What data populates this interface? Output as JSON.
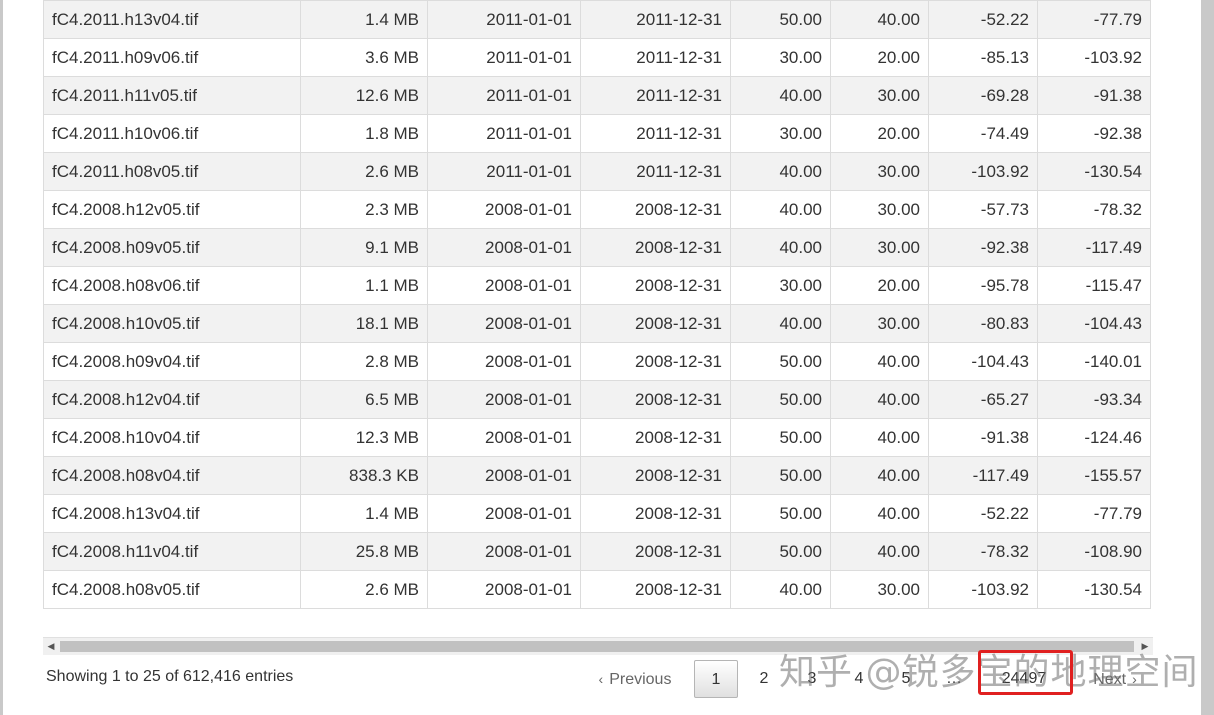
{
  "table": {
    "rows": [
      [
        "fC4.2011.h13v04.tif",
        "1.4 MB",
        "2011-01-01",
        "2011-12-31",
        "50.00",
        "40.00",
        "-52.22",
        "-77.79"
      ],
      [
        "fC4.2011.h09v06.tif",
        "3.6 MB",
        "2011-01-01",
        "2011-12-31",
        "30.00",
        "20.00",
        "-85.13",
        "-103.92"
      ],
      [
        "fC4.2011.h11v05.tif",
        "12.6 MB",
        "2011-01-01",
        "2011-12-31",
        "40.00",
        "30.00",
        "-69.28",
        "-91.38"
      ],
      [
        "fC4.2011.h10v06.tif",
        "1.8 MB",
        "2011-01-01",
        "2011-12-31",
        "30.00",
        "20.00",
        "-74.49",
        "-92.38"
      ],
      [
        "fC4.2011.h08v05.tif",
        "2.6 MB",
        "2011-01-01",
        "2011-12-31",
        "40.00",
        "30.00",
        "-103.92",
        "-130.54"
      ],
      [
        "fC4.2008.h12v05.tif",
        "2.3 MB",
        "2008-01-01",
        "2008-12-31",
        "40.00",
        "30.00",
        "-57.73",
        "-78.32"
      ],
      [
        "fC4.2008.h09v05.tif",
        "9.1 MB",
        "2008-01-01",
        "2008-12-31",
        "40.00",
        "30.00",
        "-92.38",
        "-117.49"
      ],
      [
        "fC4.2008.h08v06.tif",
        "1.1 MB",
        "2008-01-01",
        "2008-12-31",
        "30.00",
        "20.00",
        "-95.78",
        "-115.47"
      ],
      [
        "fC4.2008.h10v05.tif",
        "18.1 MB",
        "2008-01-01",
        "2008-12-31",
        "40.00",
        "30.00",
        "-80.83",
        "-104.43"
      ],
      [
        "fC4.2008.h09v04.tif",
        "2.8 MB",
        "2008-01-01",
        "2008-12-31",
        "50.00",
        "40.00",
        "-104.43",
        "-140.01"
      ],
      [
        "fC4.2008.h12v04.tif",
        "6.5 MB",
        "2008-01-01",
        "2008-12-31",
        "50.00",
        "40.00",
        "-65.27",
        "-93.34"
      ],
      [
        "fC4.2008.h10v04.tif",
        "12.3 MB",
        "2008-01-01",
        "2008-12-31",
        "50.00",
        "40.00",
        "-91.38",
        "-124.46"
      ],
      [
        "fC4.2008.h08v04.tif",
        "838.3 KB",
        "2008-01-01",
        "2008-12-31",
        "50.00",
        "40.00",
        "-117.49",
        "-155.57"
      ],
      [
        "fC4.2008.h13v04.tif",
        "1.4 MB",
        "2008-01-01",
        "2008-12-31",
        "50.00",
        "40.00",
        "-52.22",
        "-77.79"
      ],
      [
        "fC4.2008.h11v04.tif",
        "25.8 MB",
        "2008-01-01",
        "2008-12-31",
        "50.00",
        "40.00",
        "-78.32",
        "-108.90"
      ],
      [
        "fC4.2008.h08v05.tif",
        "2.6 MB",
        "2008-01-01",
        "2008-12-31",
        "40.00",
        "30.00",
        "-103.92",
        "-130.54"
      ]
    ]
  },
  "info": {
    "text": "Showing 1 to 25 of 612,416 entries"
  },
  "pagination": {
    "previous": "Previous",
    "next": "Next",
    "pages": [
      "1",
      "2",
      "3",
      "4",
      "5"
    ],
    "ellipsis": "…",
    "last": "24497",
    "current": "1"
  },
  "watermark": {
    "text": "知乎 @锐多宝的地理空间"
  },
  "colors": {
    "highlight": "#e02020",
    "row_alt": "#f2f2f2"
  }
}
